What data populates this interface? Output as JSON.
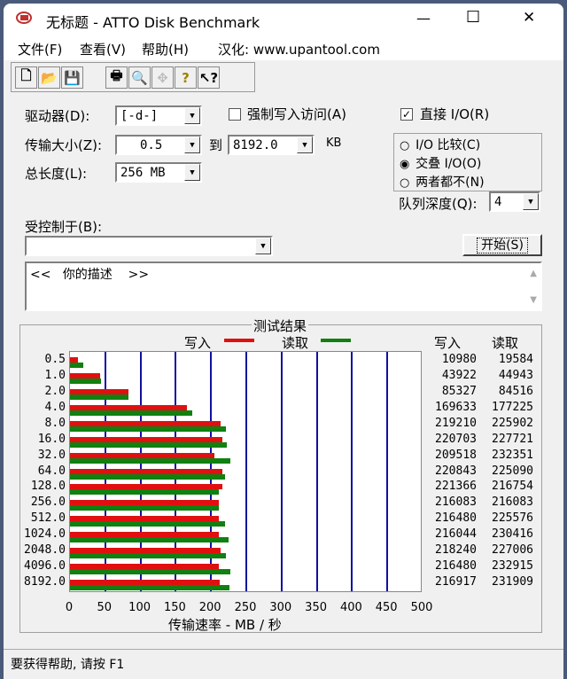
{
  "window": {
    "title": "无标题 - ATTO Disk Benchmark",
    "minimize": "—",
    "maximize": "☐",
    "close": "✕"
  },
  "menu": [
    "文件(F)",
    "查看(V)",
    "帮助(H)",
    "汉化: www.upantool.com"
  ],
  "toolbar": [
    {
      "icon": "new-icon",
      "glyph": "🗋"
    },
    {
      "icon": "open-icon",
      "glyph": "📂"
    },
    {
      "icon": "save-icon",
      "glyph": "💾"
    },
    {
      "icon": "print-icon",
      "glyph": "🖶"
    },
    {
      "icon": "print-preview-icon",
      "glyph": "🔍"
    },
    {
      "icon": "move-icon",
      "glyph": "✥"
    },
    {
      "icon": "help-icon",
      "glyph": "?"
    },
    {
      "icon": "context-help-icon",
      "glyph": "↖?"
    }
  ],
  "settings": {
    "drive_label": "驱动器(D):",
    "drive_value": "[-d-]",
    "force_write_label": "强制写入访问(A)",
    "force_write_checked": false,
    "direct_io_label": "直接 I/O(R)",
    "direct_io_checked": true,
    "transfer_label": "传输大小(Z):",
    "transfer_from": "0.5",
    "to_label": "到",
    "transfer_to": "8192.0",
    "unit": "KB",
    "length_label": "总长度(L):",
    "length_value": "256 MB",
    "radios": [
      {
        "label": "I/O 比较(C)",
        "checked": false
      },
      {
        "label": "交叠 I/O(O)",
        "checked": true
      },
      {
        "label": "两者都不(N)",
        "checked": false
      }
    ],
    "queue_label": "队列深度(Q):",
    "queue_value": "4",
    "controlled_label": "受控制于(B):",
    "controlled_value": "",
    "start_button": "开始(S)",
    "description": "<<   你的描述    >>"
  },
  "results": {
    "title": "测试结果",
    "write_legend": "写入",
    "read_legend": "读取",
    "write_header": "写入",
    "read_header": "读取",
    "write_color": "#e01010",
    "read_color": "#108010",
    "grid_color": "#1010a0"
  },
  "chart_data": {
    "type": "bar",
    "orientation": "horizontal",
    "categories": [
      "0.5",
      "1.0",
      "2.0",
      "4.0",
      "8.0",
      "16.0",
      "32.0",
      "64.0",
      "128.0",
      "256.0",
      "512.0",
      "1024.0",
      "2048.0",
      "4096.0",
      "8192.0"
    ],
    "series": [
      {
        "name": "写入",
        "unit": "KB/s",
        "values": [
          10980,
          43922,
          85327,
          169633,
          219210,
          220703,
          209518,
          220843,
          221366,
          216083,
          216480,
          216044,
          218240,
          216480,
          216917
        ]
      },
      {
        "name": "读取",
        "unit": "KB/s",
        "values": [
          19584,
          44943,
          84516,
          177225,
          225902,
          227721,
          232351,
          225090,
          216754,
          216083,
          225576,
          230416,
          227006,
          232915,
          231909
        ]
      }
    ],
    "xticks": [
      "0",
      "50",
      "100",
      "150",
      "200",
      "250",
      "300",
      "350",
      "400",
      "450",
      "500"
    ],
    "xlim": [
      0,
      500
    ],
    "xlabel": "传输速率 - MB / 秒",
    "grid": true,
    "legend": "top"
  },
  "status": "要获得帮助, 请按 F1"
}
